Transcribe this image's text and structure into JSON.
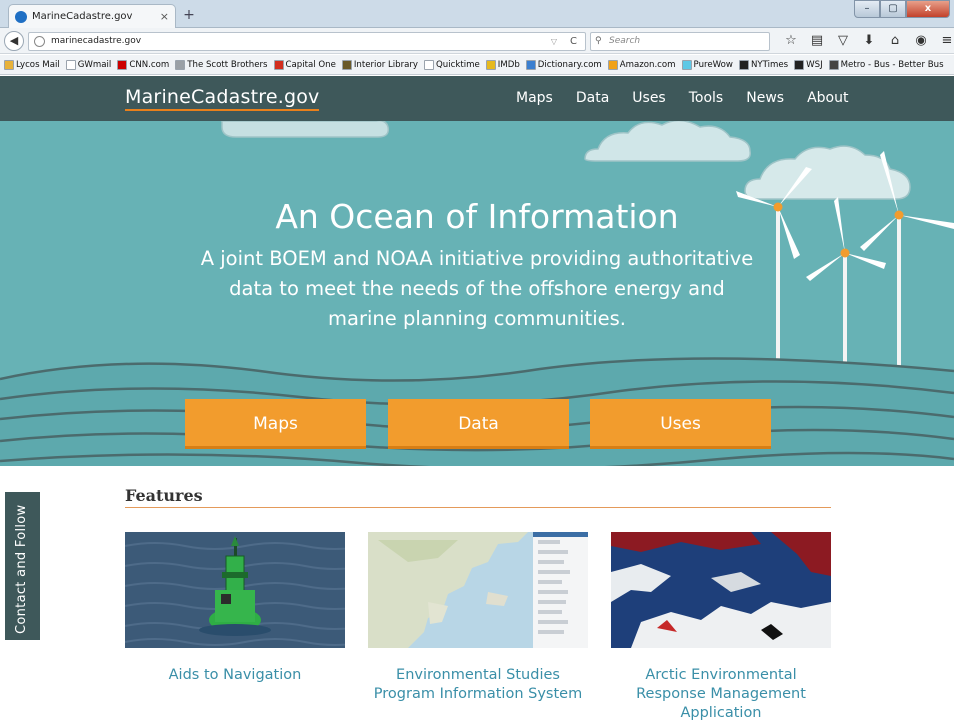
{
  "browser": {
    "tab_title": "MarineCadastre.gov",
    "tab_close": "×",
    "new_tab": "+",
    "url": "marinecadastre.gov",
    "search_placeholder": "Search",
    "window_controls": {
      "minimize": "–",
      "maximize": "▢",
      "close": "x"
    }
  },
  "bookmarks": [
    {
      "label": "Lycos Mail",
      "color": "#e8b23a"
    },
    {
      "label": "GWmail",
      "color": "#ffffff"
    },
    {
      "label": "CNN.com",
      "color": "#cc0000"
    },
    {
      "label": "The Scott Brothers",
      "color": "#9aa0a6"
    },
    {
      "label": "Capital One",
      "color": "#d22e1e"
    },
    {
      "label": "Interior Library",
      "color": "#6a5a2a"
    },
    {
      "label": "Quicktime",
      "color": "#ffffff"
    },
    {
      "label": "IMDb",
      "color": "#e6b91e"
    },
    {
      "label": "Dictionary.com",
      "color": "#3b7fd0"
    },
    {
      "label": "Amazon.com",
      "color": "#f0a21a"
    },
    {
      "label": "PureWow",
      "color": "#5ec8e6"
    },
    {
      "label": "NYTimes",
      "color": "#222222"
    },
    {
      "label": "WSJ",
      "color": "#222222"
    },
    {
      "label": "Metro - Bus - Better Bus",
      "color": "#444444"
    }
  ],
  "site": {
    "logo": "MarineCadastre.gov",
    "menu": [
      "Maps",
      "Data",
      "Uses",
      "Tools",
      "News",
      "About"
    ],
    "hero_title": "An Ocean of Information",
    "hero_subtitle": "A joint BOEM and NOAA initiative providing authoritative data to meet the needs of the offshore energy and marine planning communities.",
    "cta": [
      "Maps",
      "Data",
      "Uses"
    ],
    "contact_tab": "Contact and Follow",
    "features_heading": "Features",
    "features": [
      {
        "title": "Aids to Navigation"
      },
      {
        "title": "Environmental Studies Program Information System"
      },
      {
        "title": "Arctic Environmental Response Management Application"
      }
    ]
  },
  "colors": {
    "nav_bg": "#3e585a",
    "hero_bg": "#67b2b5",
    "accent_orange": "#f29c2d",
    "link_teal": "#3a8fa8"
  }
}
